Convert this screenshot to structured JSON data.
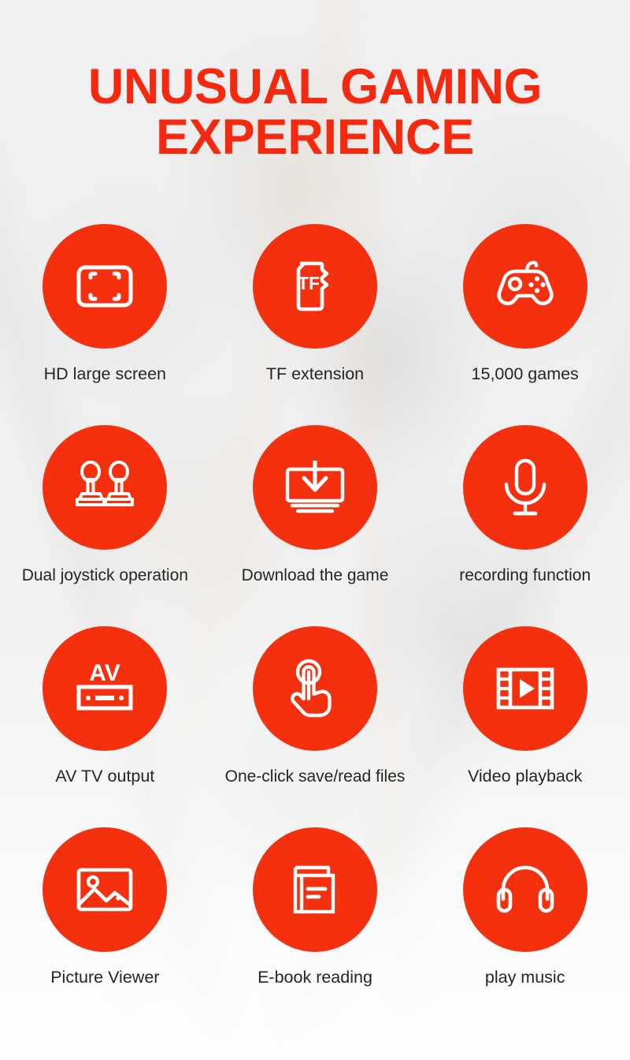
{
  "headline": {
    "line1": "UNUSUAL GAMING",
    "line2": "EXPERIENCE",
    "color": "#f5290f"
  },
  "theme": {
    "badge_color": "#f4300f",
    "icon_color": "#ffffff",
    "label_color": "#252525",
    "background_color": "#efeff0"
  },
  "features": [
    [
      {
        "label": "HD large screen",
        "icon": "fullscreen-screen-icon"
      },
      {
        "label": "TF extension",
        "icon": "tf-card-icon"
      },
      {
        "label": "15,000 games",
        "icon": "gamepad-icon"
      }
    ],
    [
      {
        "label": "Dual joystick operation",
        "icon": "dual-joystick-icon"
      },
      {
        "label": "Download the game",
        "icon": "monitor-download-icon"
      },
      {
        "label": "recording function",
        "icon": "microphone-icon"
      }
    ],
    [
      {
        "label": "AV TV output",
        "icon": "av-receiver-icon"
      },
      {
        "label": "One-click save/read files",
        "icon": "touch-hand-icon"
      },
      {
        "label": "Video playback",
        "icon": "film-play-icon"
      }
    ],
    [
      {
        "label": "Picture Viewer",
        "icon": "photo-image-icon"
      },
      {
        "label": "E-book reading",
        "icon": "book-icon"
      },
      {
        "label": "play music",
        "icon": "headphones-icon"
      }
    ]
  ],
  "icon_text": {
    "tf_card": "TF",
    "av": "AV"
  }
}
